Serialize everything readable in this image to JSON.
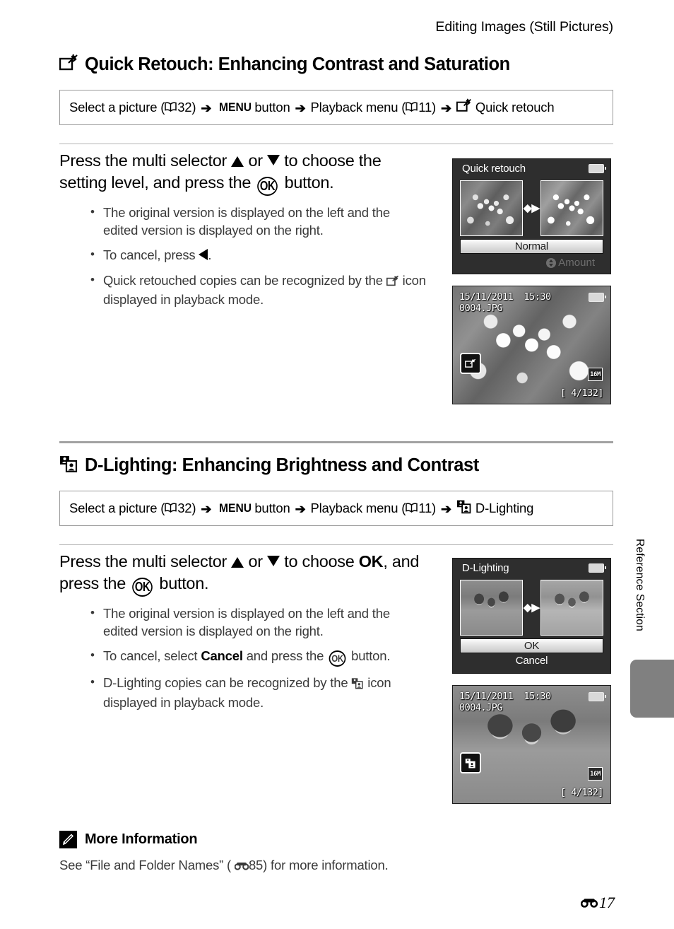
{
  "header": {
    "running_head": "Editing Images (Still Pictures)"
  },
  "sections": [
    {
      "id": "quick-retouch",
      "icon": "quick-retouch-icon",
      "heading": "Quick Retouch: Enhancing Contrast and Saturation",
      "nav": {
        "step1": "Select a picture (",
        "step1_ref": "32)",
        "menu_word": "MENU",
        "step2": "button",
        "step3": "Playback menu (",
        "step3_ref": "11)",
        "step4": "Quick retouch",
        "arrow": "➔"
      },
      "lead_pre": "Press the multi selector ",
      "lead_or": " or ",
      "lead_mid": " to choose the setting level, and press the ",
      "lead_post": " button.",
      "bullets": [
        "The original version is displayed on the left and the edited version is displayed on the right.",
        "To cancel, press ",
        "Quick retouched copies can be recognized by the "
      ],
      "bullet2_tail": ".",
      "bullet3_tail": " icon displayed in playback mode."
    },
    {
      "id": "d-lighting",
      "icon": "d-lighting-icon",
      "heading": "D-Lighting: Enhancing Brightness and Contrast",
      "nav": {
        "step1": "Select a picture (",
        "step1_ref": "32)",
        "menu_word": "MENU",
        "step2": "button",
        "step3": "Playback menu (",
        "step3_ref": "11)",
        "step4": "D-Lighting",
        "arrow": "➔"
      },
      "lead_pre": "Press the multi selector ",
      "lead_or": " or ",
      "lead_mid": " to choose ",
      "lead_ok": "OK",
      "lead_mid2": ", and press the ",
      "lead_post": " button.",
      "bullets": [
        "The original version is displayed on the left and the edited version is displayed on the right.",
        "To cancel, select ",
        "D-Lighting copies can be recognized by the "
      ],
      "bullet2_bold": "Cancel",
      "bullet2_mid": " and press the ",
      "bullet2_tail": " button.",
      "bullet3_tail": " icon displayed in playback mode."
    }
  ],
  "screens": {
    "quick_menu": {
      "title": "Quick retouch",
      "selected_option": "Normal",
      "hint_label": "Amount"
    },
    "quick_play": {
      "date": "15/11/2011",
      "time": "15:30",
      "filename": "0004.JPG",
      "counter": "[    4/132]",
      "size_badge": "16M"
    },
    "dlight_menu": {
      "title": "D-Lighting",
      "option_ok": "OK",
      "option_cancel": "Cancel"
    },
    "dlight_play": {
      "date": "15/11/2011",
      "time": "15:30",
      "filename": "0004.JPG",
      "counter": "[    4/132]",
      "size_badge": "16M"
    }
  },
  "more_information": {
    "title": "More Information",
    "body_pre": "See “File and Folder Names” (",
    "body_ref": "85)",
    "body_post": " for more information."
  },
  "side_tab": {
    "label": "Reference Section"
  },
  "footer": {
    "page_number": "17"
  }
}
